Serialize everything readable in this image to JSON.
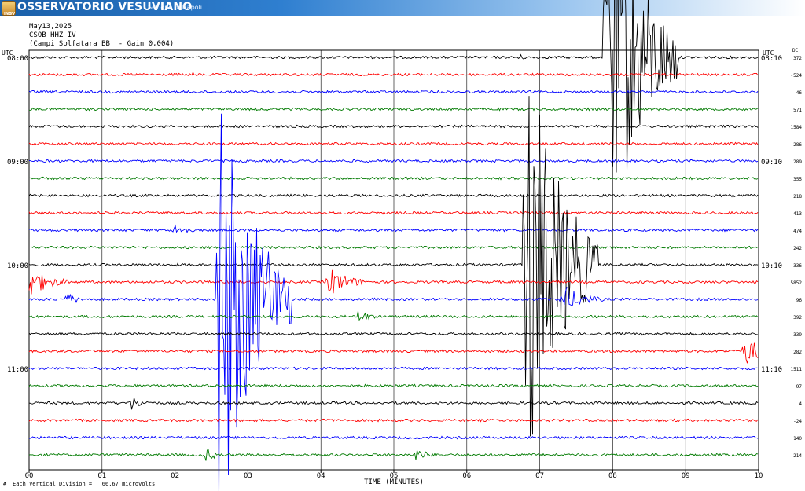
{
  "header": {
    "org_title": "OSSERVATORIO VESUVIANO",
    "org_subtitle": "Sezione di Napoli",
    "logo_text": "INGV",
    "date": "May13,2025",
    "station": "CSOB HHZ IV",
    "description": "(Campi Solfatara BB  - Gain 0,004)"
  },
  "footer": {
    "scale_note": "Each Vertical Division =   66.67 microvolts"
  },
  "colors": {
    "banner": "#2f7fd0",
    "trace_cycle": [
      "#000000",
      "#ff0000",
      "#0000ff",
      "#007a00"
    ]
  },
  "chart_data": {
    "type": "line",
    "title": "",
    "xlabel": "TIME (MINUTES)",
    "xticks": [
      "00",
      "01",
      "02",
      "03",
      "04",
      "05",
      "06",
      "07",
      "08",
      "09",
      "10"
    ],
    "xlim": [
      0,
      10
    ],
    "left_axis_label": "UTC",
    "right_axis_label": "UTC",
    "dc_label": "DC",
    "left_time_labels": [
      {
        "row": 0,
        "text": "08:00"
      },
      {
        "row": 6,
        "text": "09:00"
      },
      {
        "row": 12,
        "text": "10:00"
      },
      {
        "row": 18,
        "text": "11:00"
      }
    ],
    "right_time_labels": [
      {
        "row": 0,
        "text": "08:10"
      },
      {
        "row": 6,
        "text": "09:10"
      },
      {
        "row": 12,
        "text": "10:10"
      },
      {
        "row": 18,
        "text": "11:10"
      }
    ],
    "dc_offsets": [
      372,
      -524,
      -46,
      571,
      1584,
      286,
      289,
      355,
      218,
      413,
      474,
      242,
      336,
      5852,
      96,
      392,
      339,
      282,
      1511,
      97,
      4,
      -24,
      140,
      214
    ],
    "traces_count": 24,
    "trace_color_cycle": [
      "black",
      "red",
      "blue",
      "green"
    ],
    "events": [
      {
        "row": 1,
        "minute": 2.2,
        "amplitude": "small"
      },
      {
        "row": 0,
        "minute": 6.7,
        "amplitude": "small"
      },
      {
        "row": 10,
        "minute": 2.0,
        "amplitude": "medium"
      },
      {
        "row": 13,
        "minute": 0.0,
        "amplitude": "large"
      },
      {
        "row": 13,
        "minute": 4.1,
        "amplitude": "large"
      },
      {
        "row": 14,
        "minute": 0.5,
        "amplitude": "medium"
      },
      {
        "row": 14,
        "minute": 2.6,
        "amplitude": "saturated"
      },
      {
        "row": 15,
        "minute": 4.5,
        "amplitude": "medium"
      },
      {
        "row": 12,
        "minute": 6.8,
        "amplitude": "saturated"
      },
      {
        "row": 14,
        "minute": 7.3,
        "amplitude": "large"
      },
      {
        "row": 0,
        "minute": 7.9,
        "amplitude": "saturated"
      },
      {
        "row": 17,
        "minute": 9.8,
        "amplitude": "large"
      },
      {
        "row": 20,
        "minute": 1.4,
        "amplitude": "medium"
      },
      {
        "row": 23,
        "minute": 2.4,
        "amplitude": "medium"
      },
      {
        "row": 23,
        "minute": 5.3,
        "amplitude": "medium"
      }
    ],
    "grid": true
  }
}
